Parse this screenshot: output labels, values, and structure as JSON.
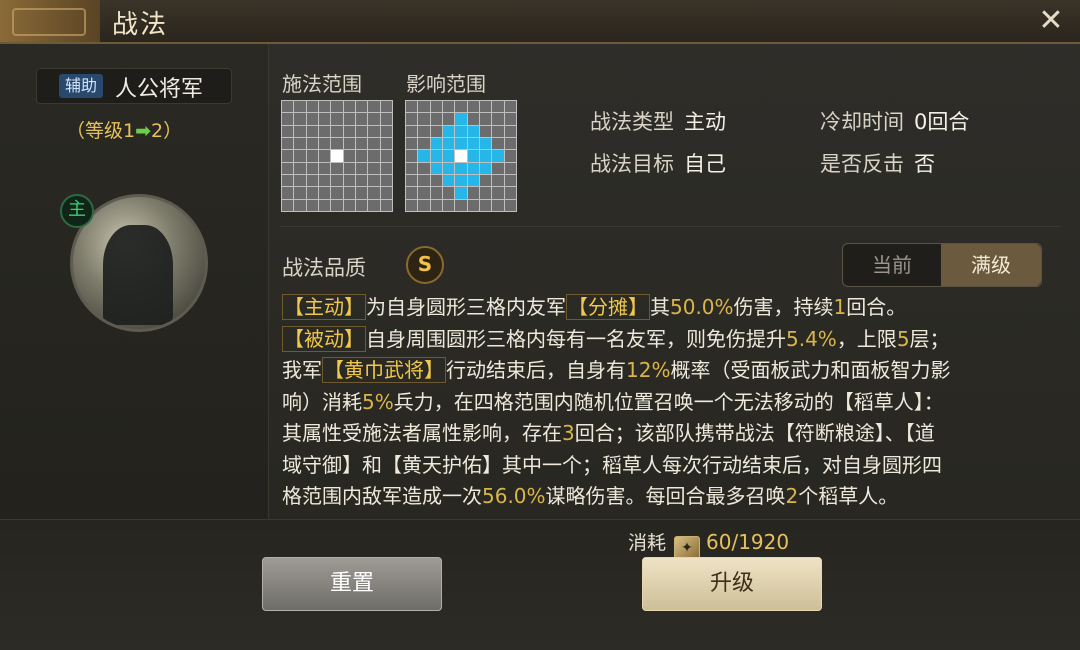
{
  "window": {
    "title": "战法"
  },
  "left": {
    "role_tag": "辅助",
    "general_name": "人公将军",
    "level_prefix": "（等级1",
    "level_arrow": "➡",
    "level_suffix": "2）",
    "main_badge": "主"
  },
  "ranges": {
    "cast_label": "施法范围",
    "effect_label": "影响范围"
  },
  "attributes": {
    "type_label": "战法类型",
    "type_value": "主动",
    "target_label": "战法目标",
    "target_value": "自己",
    "cooldown_label": "冷却时间",
    "cooldown_value": "0回合",
    "counter_label": "是否反击",
    "counter_value": "否"
  },
  "quality": {
    "label": "战法品质",
    "grade": "S"
  },
  "tabs": {
    "current": "当前",
    "max": "满级"
  },
  "description": {
    "l1a": "【主动】",
    "l1b": "为自身圆形三格内友军",
    "l1c": "【分摊】",
    "l1d": "其",
    "l1e": "50.0%",
    "l1f": "伤害，持续",
    "l1g": "1",
    "l1h": "回合。",
    "l2a": "【被动】",
    "l2b": "自身周围圆形三格内每有一名友军，则免伤提升",
    "l2c": "5.4%",
    "l2d": "，上限",
    "l2e": "5",
    "l2f": "层；",
    "l3a": "我军",
    "l3b": "【黄巾武将】",
    "l3c": "行动结束后，自身有",
    "l3d": "12%",
    "l3e": "概率（受面板武力和面板智力影",
    "l4a": "响）消耗",
    "l4b": "5%",
    "l4c": "兵力，在四格范围内随机位置召唤一个无法移动的【稻草人】：",
    "l5a": "其属性受施法者属性影响，存在",
    "l5b": "3",
    "l5c": "回合；该部队携带战法【符断粮途】、【道",
    "l6a": "域守御】和【黄天护佑】其中一个；稻草人每次行动结束后，对自身圆形四",
    "l7a": "格范围内敌军造成一次",
    "l7b": "56.0%",
    "l7c": "谋略伤害。每回合最多召唤",
    "l7d": "2",
    "l7e": "个稻草人。"
  },
  "cost": {
    "label": "消耗",
    "icon": "scroll-icon",
    "value": "60/1920"
  },
  "buttons": {
    "reset": "重置",
    "upgrade": "升级"
  },
  "colors": {
    "accent": "#f0c84c",
    "grid_blue": "#26b6e8"
  }
}
